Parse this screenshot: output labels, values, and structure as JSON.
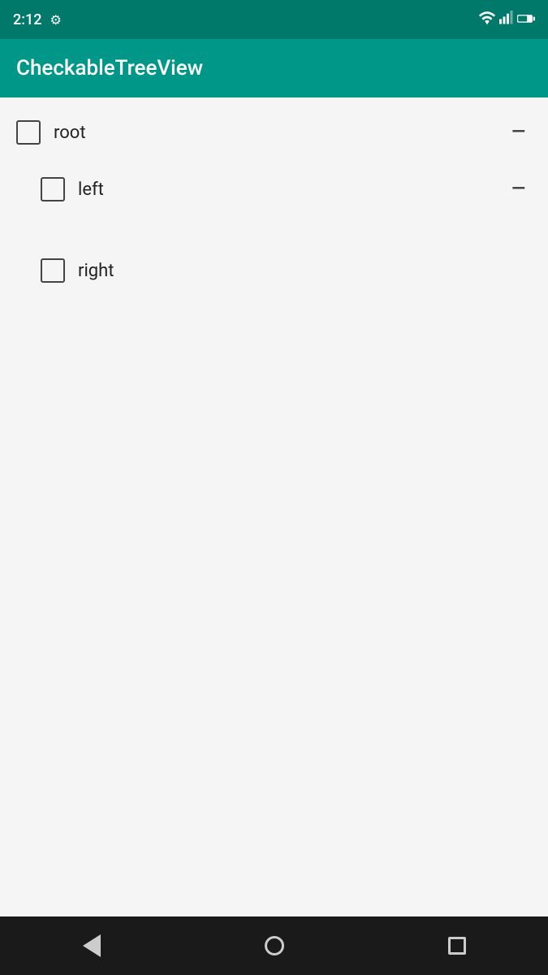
{
  "statusBar": {
    "time": "2:12",
    "gearIcon": "⚙"
  },
  "appBar": {
    "title": "CheckableTreeView"
  },
  "tree": {
    "items": [
      {
        "id": "root",
        "label": "root",
        "level": 1,
        "hasCollapse": true,
        "checked": false
      },
      {
        "id": "left",
        "label": "left",
        "level": 2,
        "hasCollapse": true,
        "checked": false
      },
      {
        "id": "right",
        "label": "right",
        "level": 2,
        "hasCollapse": false,
        "checked": false
      }
    ]
  },
  "navBar": {
    "backLabel": "back",
    "homeLabel": "home",
    "recentsLabel": "recents"
  },
  "collapseSymbol": "—"
}
